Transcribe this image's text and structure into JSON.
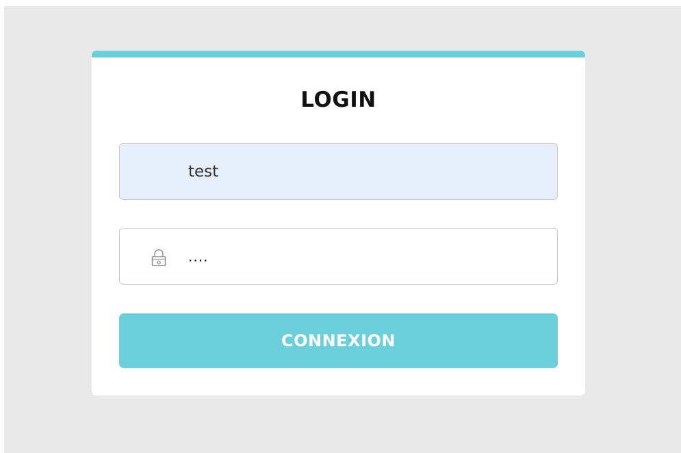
{
  "login": {
    "title": "LOGIN",
    "username": {
      "value": "test"
    },
    "password": {
      "value": "....",
      "icon": "lock-icon"
    },
    "submit_label": "CONNEXION"
  },
  "colors": {
    "accent": "#6bcfdb",
    "backdrop": "#e9e9e9",
    "autofill_field": "#e8effc",
    "card": "#ffffff"
  }
}
